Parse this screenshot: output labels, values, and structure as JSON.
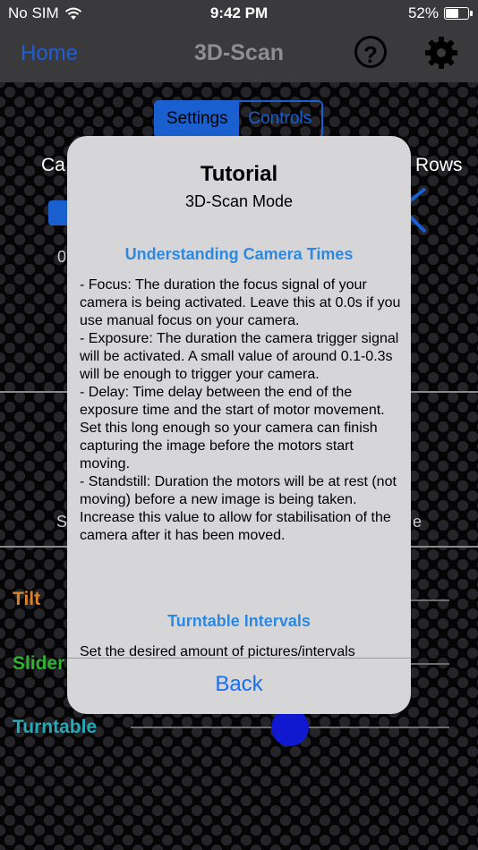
{
  "status": {
    "carrier": "No SIM",
    "time": "9:42 PM",
    "battery": "52%"
  },
  "nav": {
    "home": "Home",
    "title": "3D-Scan",
    "help": "?"
  },
  "segment": {
    "settings": "Settings",
    "controls": "Controls"
  },
  "background": {
    "camera_label_fragment": "Ca",
    "rows_label": "Rows",
    "zero_fragment": "0",
    "s_fragment": "S",
    "e_fragment": "e",
    "tilt": "Tilt",
    "slider": "Slider",
    "turntable": "Turntable"
  },
  "colors": {
    "tilt": "#d9822b",
    "slider": "#2fb22f",
    "turntable": "#27a9b7",
    "accent": "#1a5fd0",
    "link": "#2b8ae0"
  },
  "modal": {
    "title": "Tutorial",
    "subtitle": "3D-Scan Mode",
    "section1_heading": "Understanding Camera Times",
    "section1_body": "- Focus: The duration the focus signal of your camera is being activated. Leave this at 0.0s if you use manual focus on your camera.\n- Exposure: The duration the camera trigger signal will be activated. A small value of around 0.1-0.3s will be enough to trigger your camera.\n- Delay: Time delay between the end of the exposure time and the start of motor movement. Set this long enough so your camera can finish capturing the image before the motors start moving.\n- Standstill: Duration the motors will be at rest (not moving) before a new image is being taken. Increase this value to allow for stabilisation of the camera after it has been moved.",
    "section2_heading": "Turntable Intervals",
    "section2_body": "Set the desired amount of pictures/intervals",
    "back": "Back"
  }
}
